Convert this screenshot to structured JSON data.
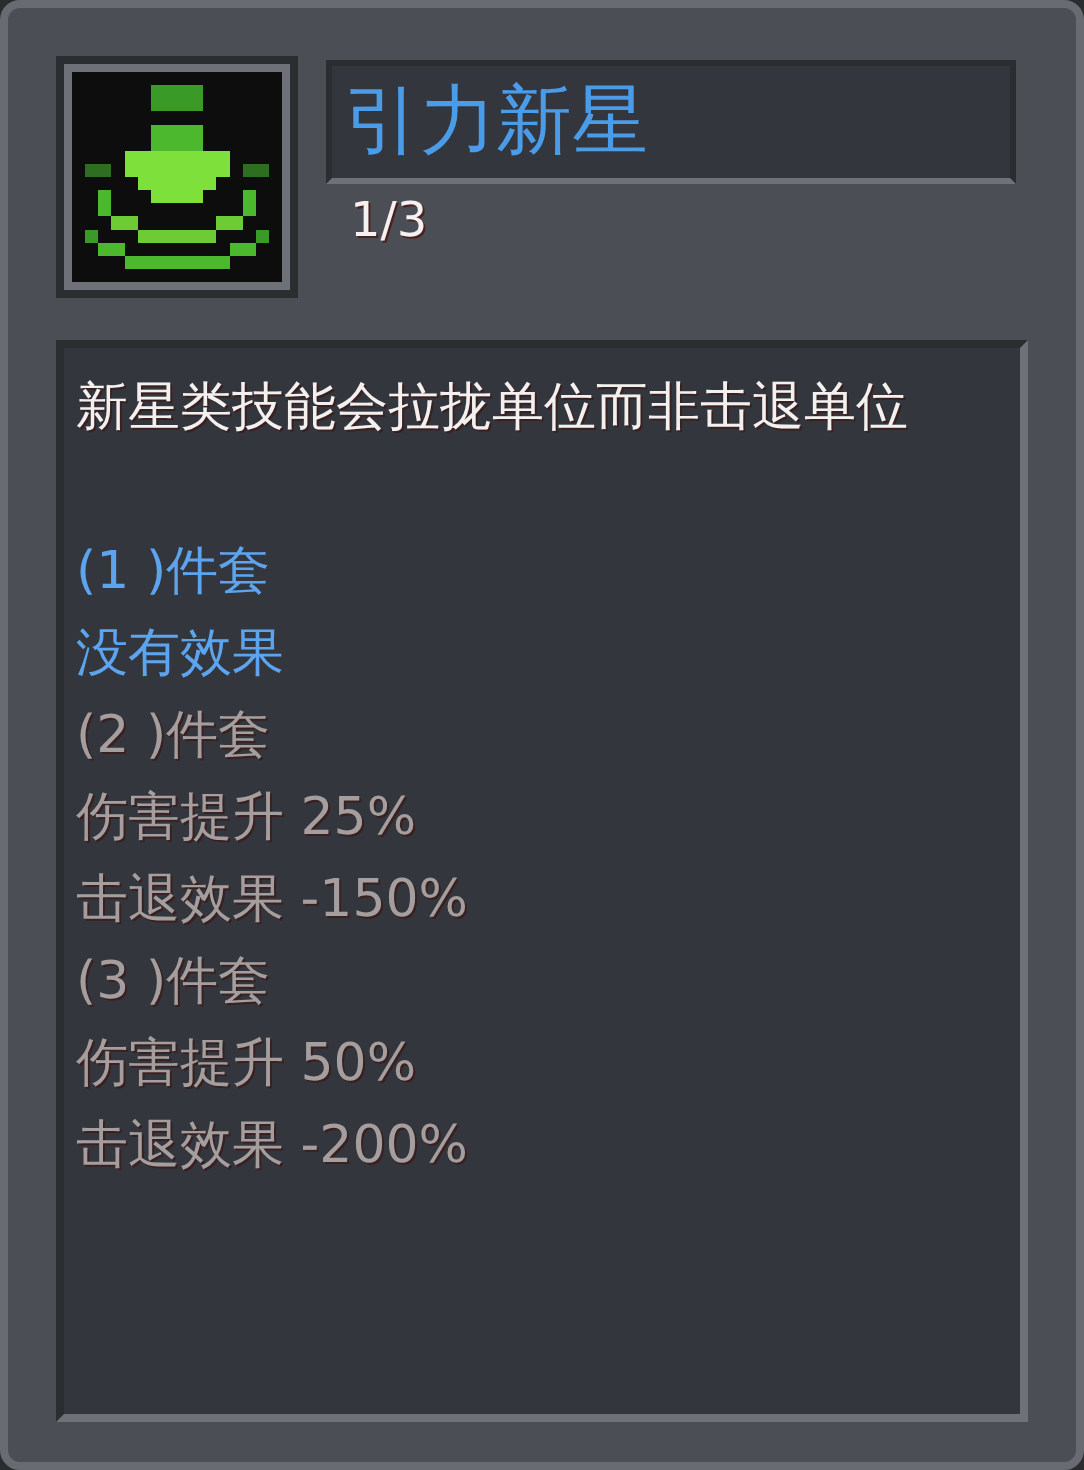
{
  "item": {
    "title": "引力新星",
    "count": "1/3"
  },
  "description": "新星类技能会拉拢单位而非击退单位",
  "set_tiers": [
    {
      "label": "(1 )件套",
      "active": true,
      "effects": [
        "没有效果"
      ]
    },
    {
      "label": "(2 )件套",
      "active": false,
      "effects": [
        "伤害提升 25%",
        "击退效果 -150%"
      ]
    },
    {
      "label": "(3 )件套",
      "active": false,
      "effects": [
        "伤害提升 50%",
        "击退效果 -200%"
      ]
    }
  ]
}
